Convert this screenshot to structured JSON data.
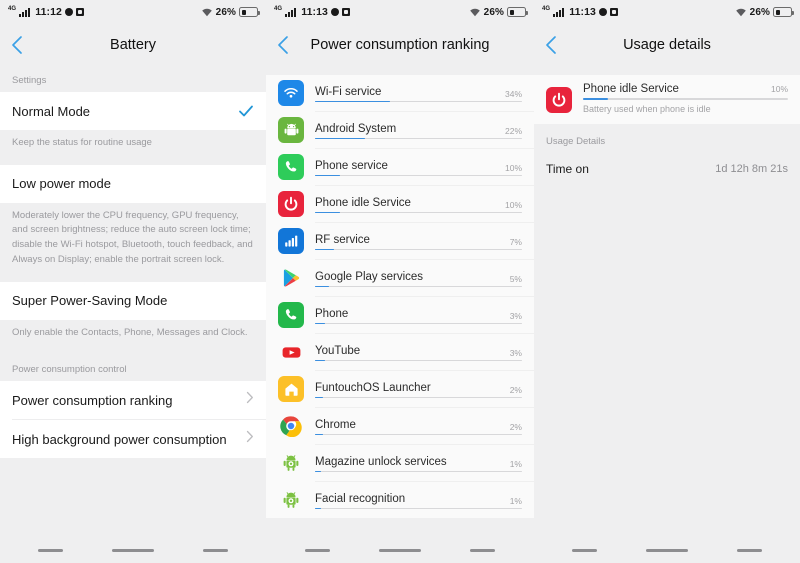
{
  "statusbar": {
    "network_label": "4G",
    "signal_icon": "signal-bars-icon",
    "wifi_icon": "wifi-icon",
    "alarm_icon": "dot-icon",
    "app_icon": "square-icon",
    "battery_icon": "battery-icon",
    "battery_pct": "26%",
    "time_panel1": "11:12",
    "time_panel2": "11:13",
    "time_panel3": "11:13"
  },
  "navbar": {
    "back_icon": "nav-back-dash",
    "home_icon": "nav-home-dash",
    "recents_icon": "nav-recents-dash"
  },
  "panel1": {
    "title": "Battery",
    "back_icon": "chevron-left-icon",
    "settings_label": "Settings",
    "normal_mode": {
      "label": "Normal Mode",
      "desc": "Keep the status for routine usage",
      "checked_icon": "check-icon",
      "accent": "#2196d6"
    },
    "low_power": {
      "label": "Low power mode",
      "desc": "Moderately lower the CPU frequency, GPU frequency, and screen brightness; reduce the auto screen lock time; disable the Wi-Fi hotspot, Bluetooth, touch feedback, and Always on Display; enable the portrait screen lock."
    },
    "super_saving": {
      "label": "Super Power-Saving Mode",
      "desc": "Only enable the Contacts, Phone, Messages and Clock."
    },
    "control_label": "Power consumption control",
    "links": [
      {
        "label": "Power consumption ranking",
        "chevron_icon": "chevron-right-icon"
      },
      {
        "label": "High background power consumption",
        "chevron_icon": "chevron-right-icon"
      }
    ]
  },
  "panel2": {
    "title": "Power consumption ranking",
    "back_icon": "chevron-left-icon",
    "bar_color": "#3b8fe0",
    "track_color": "#d8d8da",
    "items": [
      {
        "name": "Wi-Fi service",
        "pct": "34%",
        "value": 34,
        "bar_ratio": 36,
        "icon": "wifi-service-icon",
        "icon_bg": "#1e88e8"
      },
      {
        "name": "Android System",
        "pct": "22%",
        "value": 22,
        "bar_ratio": 24,
        "icon": "android-icon",
        "icon_bg": "#6ab63f"
      },
      {
        "name": "Phone service",
        "pct": "10%",
        "value": 10,
        "bar_ratio": 12,
        "icon": "phone-service-icon",
        "icon_bg": "#2ecc5a"
      },
      {
        "name": "Phone idle Service",
        "pct": "10%",
        "value": 10,
        "bar_ratio": 12,
        "icon": "power-idle-icon",
        "icon_bg": "#e8243c"
      },
      {
        "name": "RF service",
        "pct": "7%",
        "value": 7,
        "bar_ratio": 9,
        "icon": "signal-rf-icon",
        "icon_bg": "#1276d8"
      },
      {
        "name": "Google Play services",
        "pct": "5%",
        "value": 5,
        "bar_ratio": 7,
        "icon": "google-play-icon",
        "icon_bg": "#fafafa"
      },
      {
        "name": "Phone",
        "pct": "3%",
        "value": 3,
        "bar_ratio": 5,
        "icon": "phone-dialer-icon",
        "icon_bg": "#23b84b"
      },
      {
        "name": "YouTube",
        "pct": "3%",
        "value": 3,
        "bar_ratio": 5,
        "icon": "youtube-icon",
        "icon_bg": "#ffffff"
      },
      {
        "name": "FuntouchOS Launcher",
        "pct": "2%",
        "value": 2,
        "bar_ratio": 4,
        "icon": "home-launcher-icon",
        "icon_bg": "#fcc028"
      },
      {
        "name": "Chrome",
        "pct": "2%",
        "value": 2,
        "bar_ratio": 4,
        "icon": "chrome-icon",
        "icon_bg": "#fafafa"
      },
      {
        "name": "Magazine unlock services",
        "pct": "1%",
        "value": 1,
        "bar_ratio": 3,
        "icon": "android-gear-icon",
        "icon_bg": "#fafafa"
      },
      {
        "name": "Facial recognition",
        "pct": "1%",
        "value": 1,
        "bar_ratio": 3,
        "icon": "android-gear-icon",
        "icon_bg": "#fafafa"
      }
    ]
  },
  "panel3": {
    "title": "Usage details",
    "back_icon": "chevron-left-icon",
    "entry": {
      "name": "Phone idle Service",
      "pct": "10%",
      "bar_ratio": 12,
      "desc": "Battery used when phone is idle",
      "icon": "power-idle-icon",
      "icon_bg": "#e8243c"
    },
    "details_label": "Usage Details",
    "rows": [
      {
        "key": "Time on",
        "value": "1d 12h 8m 21s"
      }
    ]
  }
}
